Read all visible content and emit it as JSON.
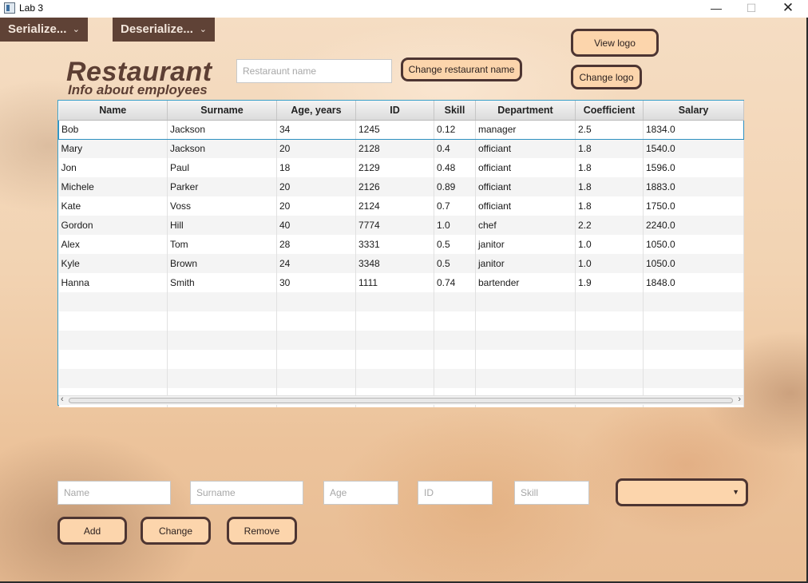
{
  "window": {
    "title": "Lab 3",
    "controls": {
      "minimize": "—",
      "maximize": "☐",
      "close": "✕"
    }
  },
  "menu": {
    "serialize_label": "Serialize...",
    "deserialize_label": "Deserialize..."
  },
  "header": {
    "title": "Restaurant",
    "subtitle": "Info about employees",
    "restaurant_name_placeholder": "Restaraunt name",
    "change_name_label": "Change restaurant name",
    "view_logo_label": "View logo",
    "change_logo_label": "Change logo"
  },
  "table": {
    "columns": [
      "Name",
      "Surname",
      "Age, years",
      "ID",
      "Skill",
      "Department",
      "Coefficient",
      "Salary"
    ],
    "rows": [
      [
        "Bob",
        "Jackson",
        "34",
        "1245",
        "0.12",
        "manager",
        "2.5",
        "1834.0"
      ],
      [
        "Mary",
        "Jackson",
        "20",
        "2128",
        "0.4",
        "officiant",
        "1.8",
        "1540.0"
      ],
      [
        "Jon",
        "Paul",
        "18",
        "2129",
        "0.48",
        "officiant",
        "1.8",
        "1596.0"
      ],
      [
        "Michele",
        "Parker",
        "20",
        "2126",
        "0.89",
        "officiant",
        "1.8",
        "1883.0"
      ],
      [
        "Kate",
        "Voss",
        "20",
        "2124",
        "0.7",
        "officiant",
        "1.8",
        "1750.0"
      ],
      [
        "Gordon",
        "Hill",
        "40",
        "7774",
        "1.0",
        "chef",
        "2.2",
        "2240.0"
      ],
      [
        "Alex",
        "Tom",
        "28",
        "3331",
        "0.5",
        "janitor",
        "1.0",
        "1050.0"
      ],
      [
        "Kyle",
        "Brown",
        "24",
        "3348",
        "0.5",
        "janitor",
        "1.0",
        "1050.0"
      ],
      [
        "Hanna",
        "Smith",
        "30",
        "1111",
        "0.74",
        "bartender",
        "1.9",
        "1848.0"
      ]
    ],
    "selected_row": 0,
    "empty_rows": 6
  },
  "form": {
    "name_placeholder": "Name",
    "surname_placeholder": "Surname",
    "age_placeholder": "Age",
    "id_placeholder": "ID",
    "skill_placeholder": "Skill",
    "department_selected": "",
    "add_label": "Add",
    "change_label": "Change",
    "remove_label": "Remove"
  },
  "colors": {
    "menu_bg": "#5f4236",
    "button_bg": "#fcd5ac",
    "button_border": "#4d3532",
    "title_text": "#5d3f34",
    "table_border": "#3aa0c9"
  }
}
